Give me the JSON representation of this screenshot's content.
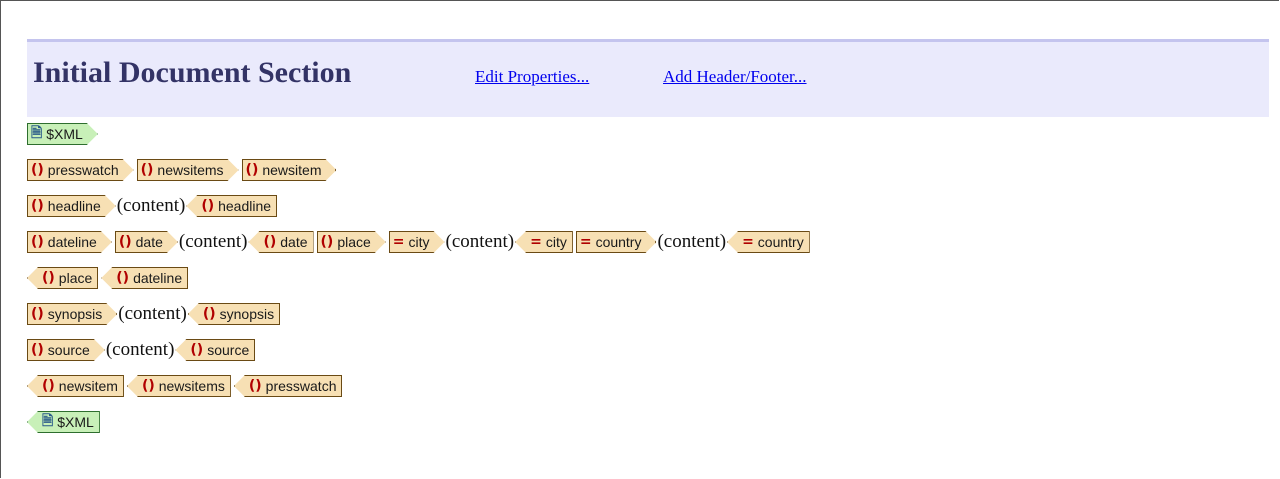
{
  "header": {
    "title": "Initial Document Section",
    "edit_properties": "Edit Properties...",
    "add_header_footer": "Add Header/Footer..."
  },
  "content_text": "(content)",
  "icons": {
    "element": "element-brace-icon",
    "attribute": "attribute-equals-icon",
    "document": "document-icon"
  },
  "rows": [
    [
      {
        "kind": "start",
        "type": "xml",
        "label": "$XML"
      }
    ],
    [
      {
        "kind": "start",
        "type": "element",
        "label": "presswatch"
      },
      {
        "kind": "start",
        "type": "element",
        "label": "newsitems"
      },
      {
        "kind": "start",
        "type": "element",
        "label": "newsitem"
      }
    ],
    [
      {
        "kind": "start",
        "type": "element",
        "label": "headline"
      },
      {
        "kind": "content"
      },
      {
        "kind": "end",
        "type": "element",
        "label": "headline"
      }
    ],
    [
      {
        "kind": "start",
        "type": "element",
        "label": "dateline"
      },
      {
        "kind": "start",
        "type": "element",
        "label": "date"
      },
      {
        "kind": "content"
      },
      {
        "kind": "end",
        "type": "element",
        "label": "date"
      },
      {
        "kind": "start",
        "type": "element",
        "label": "place"
      },
      {
        "kind": "start",
        "type": "attribute",
        "label": "city"
      },
      {
        "kind": "content"
      },
      {
        "kind": "end",
        "type": "attribute",
        "label": "city"
      },
      {
        "kind": "start",
        "type": "attribute",
        "label": "country"
      },
      {
        "kind": "content"
      },
      {
        "kind": "end",
        "type": "attribute",
        "label": "country"
      }
    ],
    [
      {
        "kind": "end",
        "type": "element",
        "label": "place"
      },
      {
        "kind": "end",
        "type": "element",
        "label": "dateline"
      }
    ],
    [
      {
        "kind": "start",
        "type": "element",
        "label": "synopsis"
      },
      {
        "kind": "content"
      },
      {
        "kind": "end",
        "type": "element",
        "label": "synopsis"
      }
    ],
    [
      {
        "kind": "start",
        "type": "element",
        "label": "source"
      },
      {
        "kind": "content"
      },
      {
        "kind": "end",
        "type": "element",
        "label": "source"
      }
    ],
    [
      {
        "kind": "end",
        "type": "element",
        "label": "newsitem"
      },
      {
        "kind": "end",
        "type": "element",
        "label": "newsitems"
      },
      {
        "kind": "end",
        "type": "element",
        "label": "presswatch"
      }
    ],
    [
      {
        "kind": "end",
        "type": "xml",
        "label": "$XML"
      }
    ]
  ]
}
